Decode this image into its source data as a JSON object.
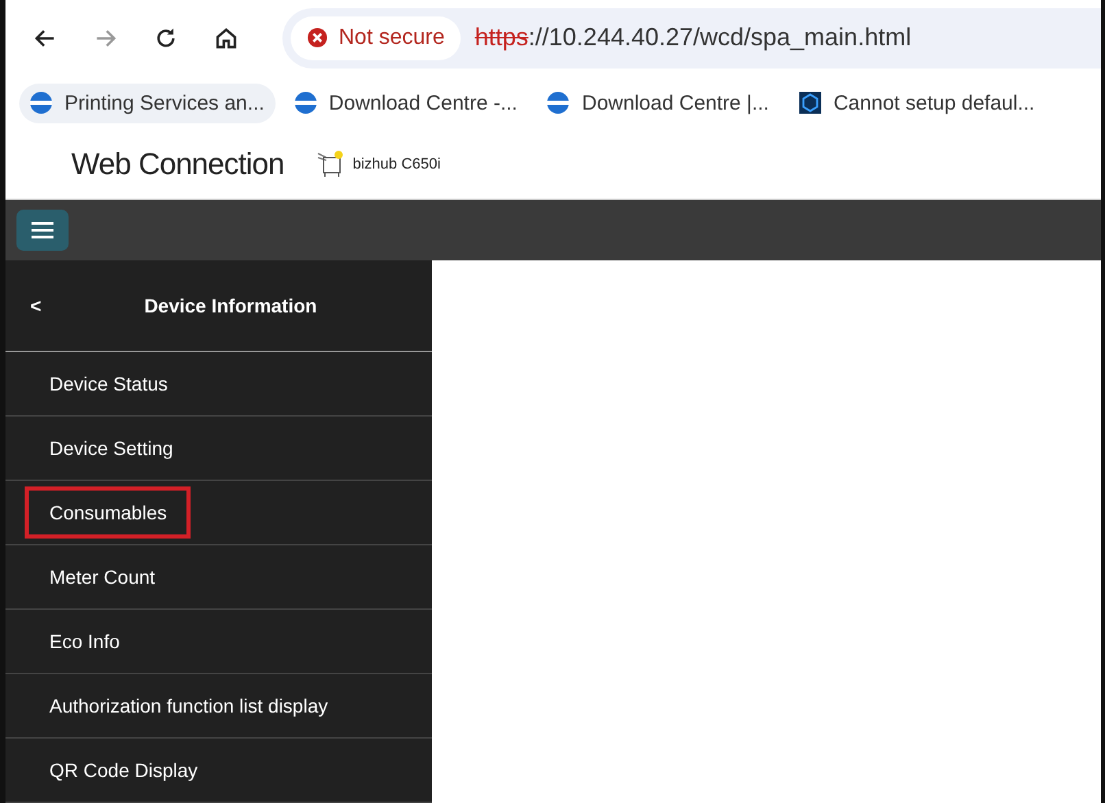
{
  "browser": {
    "security_label": "Not secure",
    "url_scheme": "https",
    "url_rest": "://10.244.40.27/wcd/spa_main.html",
    "bookmarks": [
      {
        "label": "Printing Services an...",
        "kind": "globe"
      },
      {
        "label": "Download Centre -...",
        "kind": "globe"
      },
      {
        "label": "Download Centre |...",
        "kind": "globe"
      },
      {
        "label": "Cannot setup defaul...",
        "kind": "cube"
      }
    ]
  },
  "header": {
    "logo": "Web Connection",
    "device": "bizhub C650i"
  },
  "sidebar": {
    "title": "Device Information",
    "back": "<",
    "items": [
      {
        "label": "Device Status",
        "highlighted": false
      },
      {
        "label": "Device Setting",
        "highlighted": false
      },
      {
        "label": "Consumables",
        "highlighted": true
      },
      {
        "label": "Meter Count",
        "highlighted": false
      },
      {
        "label": "Eco Info",
        "highlighted": false
      },
      {
        "label": "Authorization function list display",
        "highlighted": false
      },
      {
        "label": "QR Code Display",
        "highlighted": false
      }
    ]
  }
}
